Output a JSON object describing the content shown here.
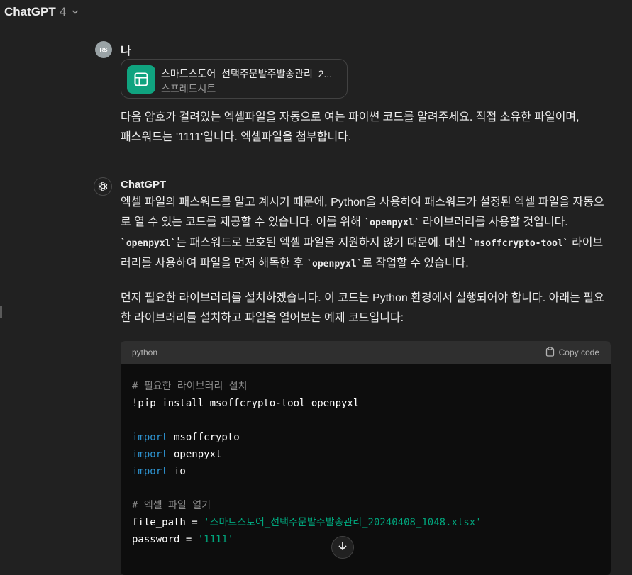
{
  "header": {
    "model_name": "ChatGPT",
    "model_version": "4"
  },
  "user": {
    "initials": "RS",
    "name": "나",
    "attachment": {
      "file_name": "스마트스토어_선택주문발주발송관리_2...",
      "file_type": "스프레드시트"
    },
    "message_line1": "다음 암호가 걸려있는 엑셀파일을 자동으로 여는 파이썬 코드를 알려주세요. 직접 소유한 파일이며,",
    "message_line2": "패스워드는 '1111'입니다. 엑셀파일을 첨부합니다."
  },
  "assistant": {
    "name": "ChatGPT",
    "paragraph1": {
      "t1": "엑셀 파일의 패스워드를 알고 계시기 때문에, Python을 사용하여 패스워드가 설정된 엑셀 파일을 자동으로 열 수 있는 코드를 제공할 수 있습니다. 이를 위해 ",
      "c1": "`openpyxl`",
      "t2": " 라이브러리를 사용할 것입니다. ",
      "c2": "`openpyxl`",
      "t3": "는 패스워드로 보호된 엑셀 파일을 지원하지 않기 때문에, 대신 ",
      "c3": "`msoffcrypto-tool`",
      "t4": " 라이브러리를 사용하여 파일을 먼저 해독한 후 ",
      "c4": "`openpyxl`",
      "t5": "로 작업할 수 있습니다."
    },
    "paragraph2": "먼저 필요한 라이브러리를 설치하겠습니다. 이 코드는 Python 환경에서 실행되어야 합니다. 아래는 필요한 라이브러리를 설치하고 파일을 열어보는 예제 코드입니다:",
    "code_block": {
      "language": "python",
      "copy_label": "Copy code",
      "lines": {
        "l1": "# 필요한 라이브러리 설치",
        "l2": "!pip install msoffcrypto-tool openpyxl",
        "kw_import": "import",
        "l4_rest": " msoffcrypto",
        "l5_rest": " openpyxl",
        "l6_rest": " io",
        "l8": "# 엑셀 파일 열기",
        "l9_pre": "file_path = ",
        "l9_str": "'스마트스토어_선택주문발주발송관리_20240408_1048.xlsx'",
        "l10_pre": "password = ",
        "l10_str": "'1111'"
      }
    }
  },
  "colors": {
    "background": "#212121",
    "code_bg": "#0d0d0d",
    "keyword": "#2e95d3",
    "string": "#00a67d",
    "file_icon": "#10a37f"
  },
  "icons": [
    "chevron-down-icon",
    "spreadsheet-icon",
    "openai-logo-icon",
    "clipboard-icon",
    "arrow-down-icon"
  ]
}
